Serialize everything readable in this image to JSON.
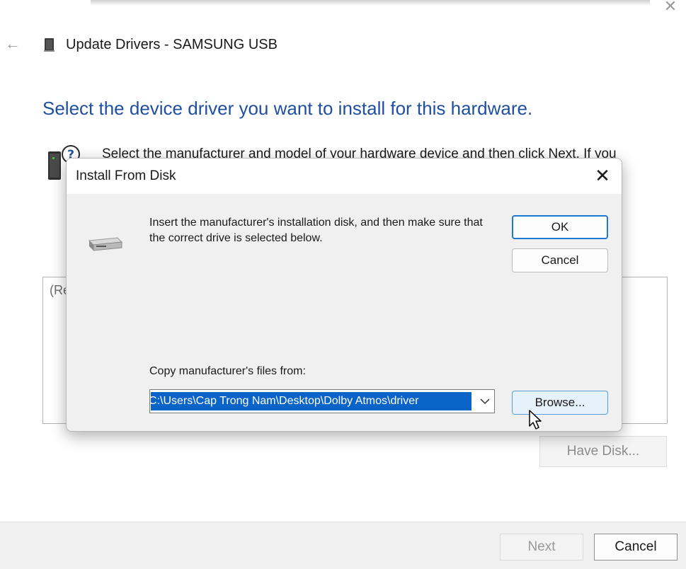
{
  "wizard": {
    "title": "Update Drivers - SAMSUNG USB",
    "heading": "Select the device driver you want to install for this hardware.",
    "instruction": "Select the manufacturer and model of your hardware device and then click Next. If you",
    "list_partial_text": "(Re",
    "have_disk_label": "Have Disk...",
    "next_label": "Next",
    "cancel_label": "Cancel"
  },
  "dialog": {
    "title": "Install From Disk",
    "message": "Insert the manufacturer's installation disk, and then make sure that the correct drive is selected below.",
    "ok_label": "OK",
    "cancel_label": "Cancel",
    "copy_label": "Copy manufacturer's files from:",
    "path_value": "C:\\Users\\Cap Trong Nam\\Desktop\\Dolby Atmos\\driver",
    "browse_label": "Browse..."
  },
  "icons": {
    "back": "back-arrow-icon",
    "title": "device-icon",
    "hardware": "hardware-help-icon",
    "disk": "disk-drive-icon",
    "dropdown": "chevron-down-icon",
    "close": "close-icon",
    "cursor": "mouse-pointer-icon"
  },
  "colors": {
    "heading": "#1e4fa0",
    "selection": "#0a64c8",
    "ok_border": "#1f78d1"
  }
}
